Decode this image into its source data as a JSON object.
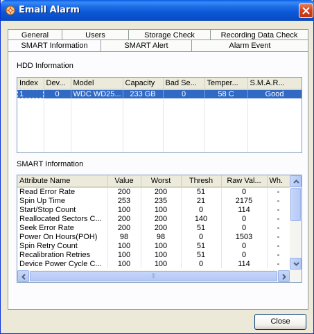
{
  "window": {
    "title": "Email Alarm",
    "accent": "#0b57d6",
    "close_color": "#d2421d"
  },
  "tabs_top": [
    "General",
    "Users",
    "Storage Check",
    "Recording Data Check"
  ],
  "tabs_bottom": [
    "SMART Information",
    "SMART Alert",
    "Alarm Event"
  ],
  "active_tab": "SMART Information",
  "hdd": {
    "section_label": "HDD Information",
    "columns": [
      "Index",
      "Dev...",
      "Model",
      "Capacity",
      "Bad Se...",
      "Temper...",
      "S.M.A.R..."
    ],
    "rows": [
      [
        "1",
        "0",
        "WDC WD25...",
        "233 GB",
        "0",
        "58 C",
        "Good"
      ]
    ],
    "selected_row": 0
  },
  "smart": {
    "section_label": "SMART Information",
    "columns": [
      "Attribute Name",
      "Value",
      "Worst",
      "Thresh",
      "Raw Val...",
      "Wh."
    ],
    "rows": [
      [
        "Read Error Rate",
        "200",
        "200",
        "51",
        "0",
        "-"
      ],
      [
        "Spin Up Time",
        "253",
        "235",
        "21",
        "2175",
        "-"
      ],
      [
        "Start/Stop Count",
        "100",
        "100",
        "0",
        "114",
        "-"
      ],
      [
        "Reallocated Sectors C...",
        "200",
        "200",
        "140",
        "0",
        "-"
      ],
      [
        "Seek Error Rate",
        "200",
        "200",
        "51",
        "0",
        "-"
      ],
      [
        "Power On Hours(POH)",
        "98",
        "98",
        "0",
        "1503",
        "-"
      ],
      [
        "Spin Retry Count",
        "100",
        "100",
        "51",
        "0",
        "-"
      ],
      [
        "Recalibration Retries",
        "100",
        "100",
        "51",
        "0",
        "-"
      ],
      [
        "Device Power Cycle C...",
        "100",
        "100",
        "0",
        "114",
        "-"
      ]
    ],
    "scroll_glyph": "|||"
  },
  "footer": {
    "close_label": "Close"
  },
  "icons": {
    "app": "alarm-icon",
    "close": "close-icon"
  }
}
